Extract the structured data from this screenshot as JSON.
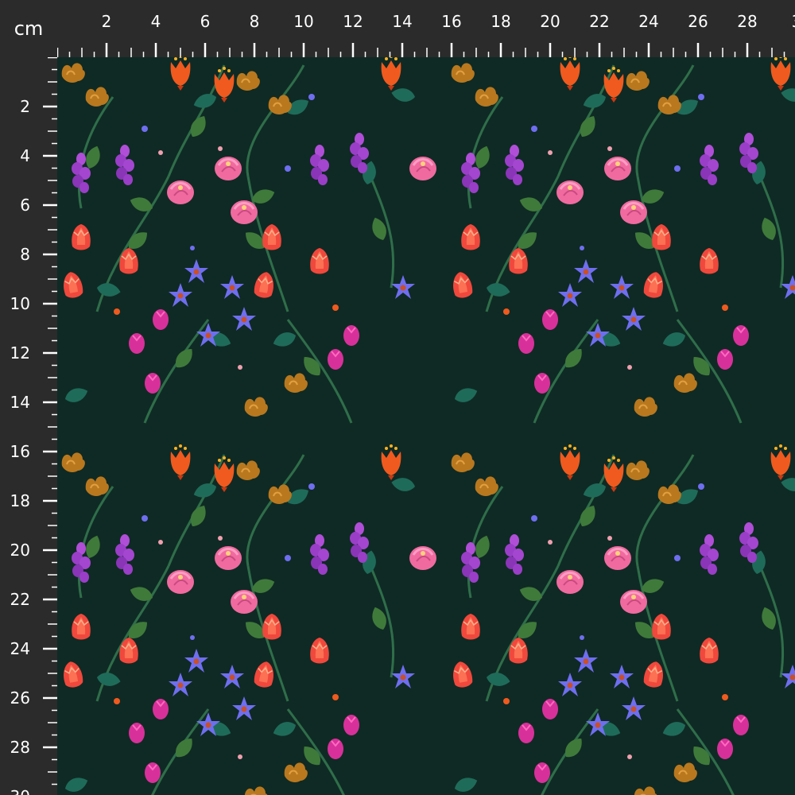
{
  "ruler": {
    "unit": "cm",
    "top_labels": [
      "2",
      "4",
      "6",
      "8",
      "10",
      "12",
      "14",
      "16",
      "18",
      "20",
      "22",
      "24",
      "26",
      "28",
      "3"
    ],
    "left_labels": [
      "2",
      "4",
      "6",
      "8",
      "10",
      "12",
      "14",
      "16",
      "18",
      "20",
      "22",
      "24",
      "26",
      "28",
      "30"
    ]
  },
  "colors": {
    "ruler_bg": "#2b2b2b",
    "ruler_text": "#ffffff",
    "fabric_bg": "#0f2a24",
    "leaf_green": "#3f7a3a",
    "leaf_teal": "#1f6b5a",
    "tulip_red": "#f0483c",
    "bell_orange": "#f05a1e",
    "rose_pink": "#f06aa0",
    "lavender_purple": "#9a3ec8",
    "magenta": "#d8309a",
    "star_blue": "#6f6ef0",
    "mustard": "#b9781e"
  },
  "icons": {
    "tulip": "tulip-icon",
    "bell_flower": "bell-flower-icon",
    "rose": "rose-bud-icon",
    "lavender": "lavender-spike-icon",
    "star_flower": "star-flower-icon",
    "mustard_bloom": "mustard-bloom-icon",
    "leaf": "leaf-icon"
  }
}
